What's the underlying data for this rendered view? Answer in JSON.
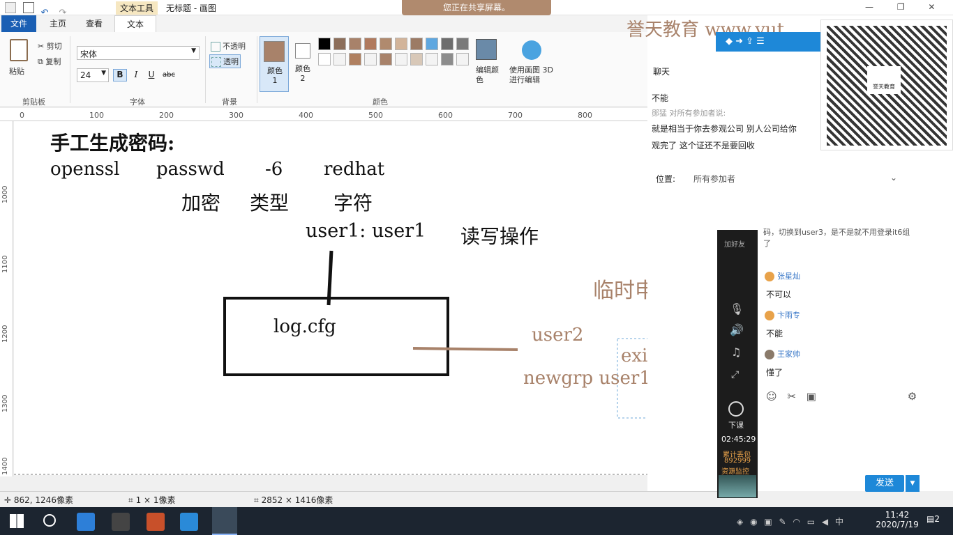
{
  "window": {
    "title": "无标题 - 画图",
    "context_tab": "文本工具",
    "share_banner": "您正在共享屏幕。"
  },
  "tabs": [
    "文件",
    "主页",
    "查看",
    "文本"
  ],
  "ribbon": {
    "clipboard": {
      "paste": "粘贴",
      "cut": "剪切",
      "copy": "复制",
      "group": "剪贴板"
    },
    "font": {
      "family": "宋体",
      "size": "24",
      "bold": "B",
      "italic": "I",
      "underline": "U",
      "strike": "abc",
      "group": "字体"
    },
    "background": {
      "opaque": "不透明",
      "transparent": "透明",
      "group": "背景"
    },
    "colors": {
      "color1": "颜色 1",
      "color2": "颜色 2",
      "group": "颜色",
      "edit_colors": "编辑颜色",
      "paint3d": "使用画图 3D 进行编辑",
      "color1_hex": "#a8826a",
      "color2_hex": "#ffffff",
      "row1": [
        "#000000",
        "#8c6e5a",
        "#a8826a",
        "#b07a5e",
        "#b08a6e",
        "#d2b49a",
        "#9c7b65",
        "#5ea7e0",
        "#6d6d6d",
        "#7a7a7a"
      ],
      "row2": [
        "#ffffff",
        "#f3f3f3",
        "#b08060",
        "#f3f3f3",
        "#a8826a",
        "#f3f3f3",
        "#d8c8b8",
        "#f3f3f3",
        "#8c8c8c",
        "#f3f3f3"
      ]
    }
  },
  "ruler": {
    "h_ticks": [
      "0",
      "100",
      "200",
      "300",
      "400",
      "500",
      "600",
      "700",
      "800"
    ],
    "v_ticks": [
      "1000",
      "1100",
      "1200",
      "1300",
      "1400"
    ]
  },
  "canvas": {
    "heading": "手工生成密码:",
    "cmd": [
      "openssl",
      "passwd",
      "-6",
      "redhat"
    ],
    "cmd_labels": [
      "加密",
      "类型",
      "字符"
    ],
    "user_line": "user1: user1",
    "rw_ops": "读写操作",
    "file_box": "log.cfg",
    "temp_apply": "临时申请",
    "user2": "user2",
    "exit": "exit",
    "newgrp": "newgrp user1"
  },
  "status": {
    "cursor": "862, 1246像素",
    "selection": "1 × 1像素",
    "image_size": "2852 × 1416像素"
  },
  "watermark": "誉天教育 www.yut",
  "chat": {
    "title": "聊天",
    "messages": [
      {
        "sender": "",
        "text": "不能"
      },
      {
        "sender": "郧猛 对所有参加者说:",
        "text": "就是相当于你去参观公司 别人公司给你"
      },
      {
        "sender": "",
        "text": "观完了 这个证还不是要回收"
      }
    ],
    "location_label": "位置:",
    "location_value": "所有参加者",
    "qr_caption": "誉天教育",
    "stream_messages": [
      {
        "sender": "",
        "text": "码，切换到user3，是不是就不用登录it6组了"
      },
      {
        "sender": "张星灿",
        "text": "不可以"
      },
      {
        "sender": "卞雨专",
        "text": "不能"
      },
      {
        "sender": "王家帅",
        "text": "懂了"
      }
    ],
    "send": "发送",
    "add_friend": "加好友",
    "leave": "下课",
    "timer": "02:45:29",
    "package": "累计丢包",
    "package_num": "892999",
    "resource": "资源监控"
  },
  "taskbar": {
    "time": "11:42",
    "date": "2020/7/19",
    "ime": "中",
    "notifications": "2"
  }
}
